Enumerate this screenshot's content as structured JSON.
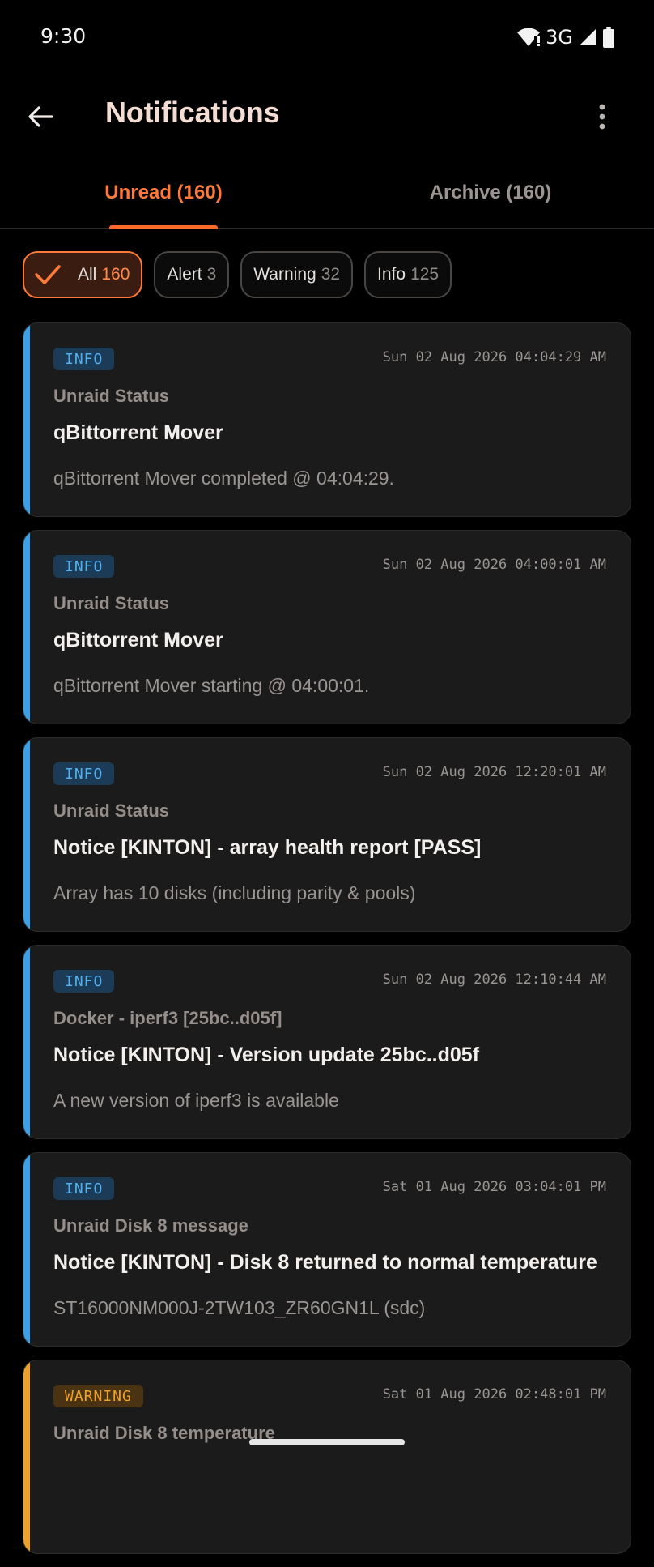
{
  "status_bar": {
    "time": "9:30",
    "network": "3G"
  },
  "header": {
    "title": "Notifications"
  },
  "tabs": [
    {
      "label": "Unread (160)",
      "selected": true
    },
    {
      "label": "Archive (160)",
      "selected": false
    }
  ],
  "filters": [
    {
      "label": "All",
      "count": "160",
      "selected": true
    },
    {
      "label": "Alert",
      "count": "3",
      "selected": false
    },
    {
      "label": "Warning",
      "count": "32",
      "selected": false
    },
    {
      "label": "Info",
      "count": "125",
      "selected": false
    }
  ],
  "notifications": [
    {
      "level": "INFO",
      "timestamp": "Sun 02 Aug 2026 04:04:29 AM",
      "source": "Unraid Status",
      "title": "qBittorrent Mover",
      "message": "qBittorrent Mover completed @ 04:04:29."
    },
    {
      "level": "INFO",
      "timestamp": "Sun 02 Aug 2026 04:00:01 AM",
      "source": "Unraid Status",
      "title": "qBittorrent Mover",
      "message": "qBittorrent Mover starting @ 04:00:01."
    },
    {
      "level": "INFO",
      "timestamp": "Sun 02 Aug 2026 12:20:01 AM",
      "source": "Unraid Status",
      "title": "Notice [KINTON] - array health report [PASS]",
      "message": "Array has 10 disks (including parity & pools)"
    },
    {
      "level": "INFO",
      "timestamp": "Sun 02 Aug 2026 12:10:44 AM",
      "source": "Docker - iperf3 [25bc..d05f]",
      "title": "Notice [KINTON] - Version update 25bc..d05f",
      "message": "A new version of iperf3 is available"
    },
    {
      "level": "INFO",
      "timestamp": "Sat 01 Aug 2026 03:04:01 PM",
      "source": "Unraid Disk 8 message",
      "title": "Notice [KINTON] - Disk 8 returned to normal temperature",
      "message": "ST16000NM000J-2TW103_ZR60GN1L (sdc)"
    },
    {
      "level": "WARNING",
      "timestamp": "Sat 01 Aug 2026 02:48:01 PM",
      "source": "Unraid Disk 8 temperature",
      "title": "",
      "message": ""
    }
  ],
  "colors": {
    "accent": "#ff6a2b",
    "info": "#3aa0e8",
    "warning": "#f0a228",
    "background": "#000000",
    "card": "#1c1b1b"
  }
}
